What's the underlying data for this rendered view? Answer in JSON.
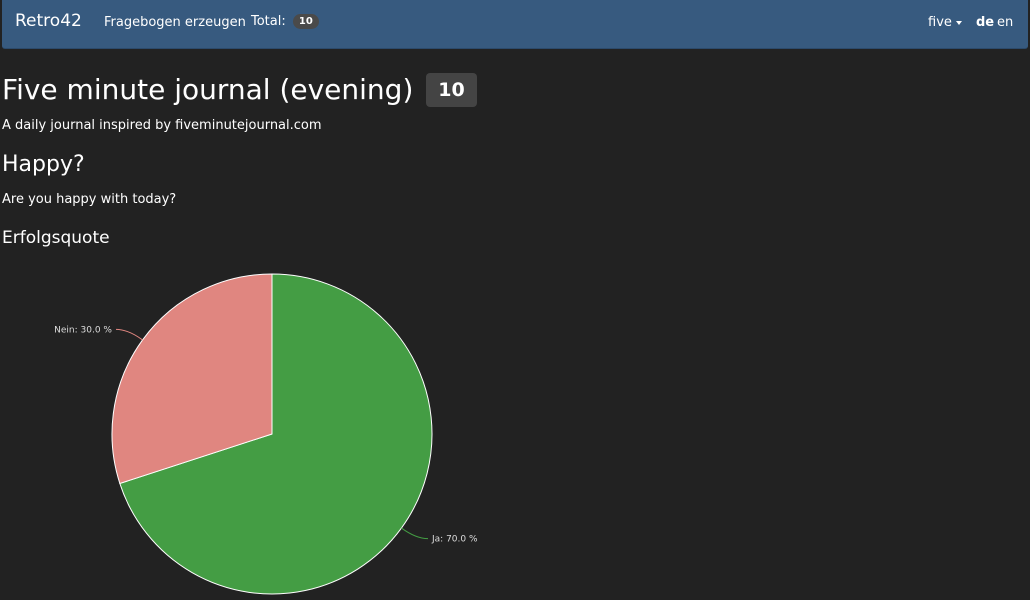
{
  "navbar": {
    "brand": "Retro42",
    "create_link": "Fragebogen erzeugen",
    "total_label": "Total:",
    "total_count": "10",
    "user_menu": "five",
    "lang_de": "de",
    "lang_en": "en"
  },
  "survey": {
    "title": "Five minute journal (evening)",
    "count": "10",
    "description": "A daily journal inspired by fiveminutejournal.com"
  },
  "question": {
    "title": "Happy?",
    "text": "Are you happy with today?"
  },
  "chart_data": {
    "type": "pie",
    "title": "Erfolgsquote",
    "slices": [
      {
        "name": "Ja",
        "value": 70.0,
        "label": "Ja: 70.0 %",
        "color": "#449d44"
      },
      {
        "name": "Nein",
        "value": 30.0,
        "label": "Nein: 30.0 %",
        "color": "#e08680"
      }
    ]
  }
}
